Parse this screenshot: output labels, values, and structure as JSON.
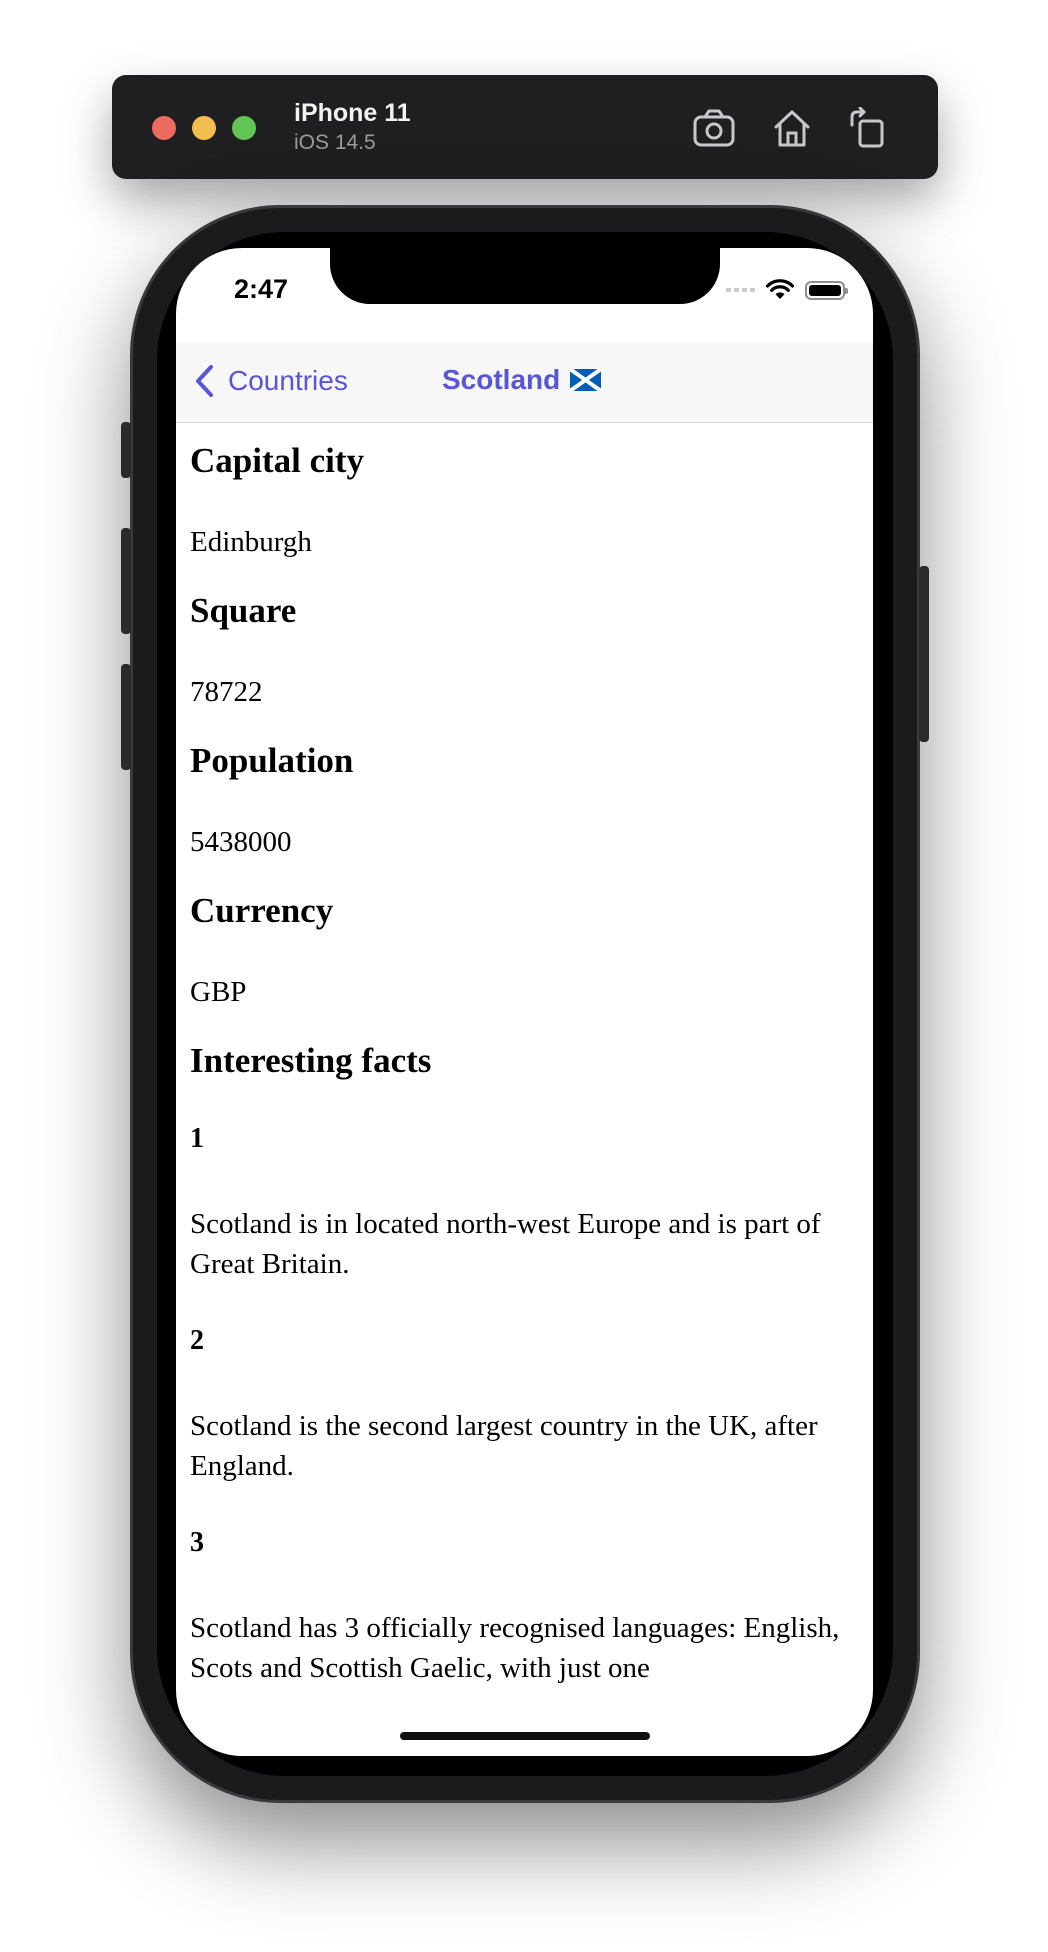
{
  "simulator": {
    "device": "iPhone 11",
    "os": "iOS 14.5",
    "buttons": [
      "screenshot-icon",
      "home-icon",
      "rotate-icon"
    ]
  },
  "status_bar": {
    "time": "2:47",
    "battery_level": 1.0
  },
  "nav": {
    "back_label": "Countries",
    "title": "Scotland",
    "accent_color": "#5856d6",
    "title_icon": "scotland-flag-icon"
  },
  "content": {
    "capital_heading": "Capital city",
    "capital_value": "Edinburgh",
    "square_heading": "Square",
    "square_value": "78722",
    "population_heading": "Population",
    "population_value": "5438000",
    "currency_heading": "Currency",
    "currency_value": "GBP",
    "facts_heading": "Interesting facts",
    "facts": [
      {
        "number": "1",
        "text": "Scotland is in located north-west Europe and is part of Great Britain."
      },
      {
        "number": "2",
        "text": "Scotland is the second largest country in the UK, after England."
      },
      {
        "number": "3",
        "text": "Scotland has 3 officially recognised languages: English, Scots and Scottish Gaelic, with just one"
      }
    ]
  }
}
